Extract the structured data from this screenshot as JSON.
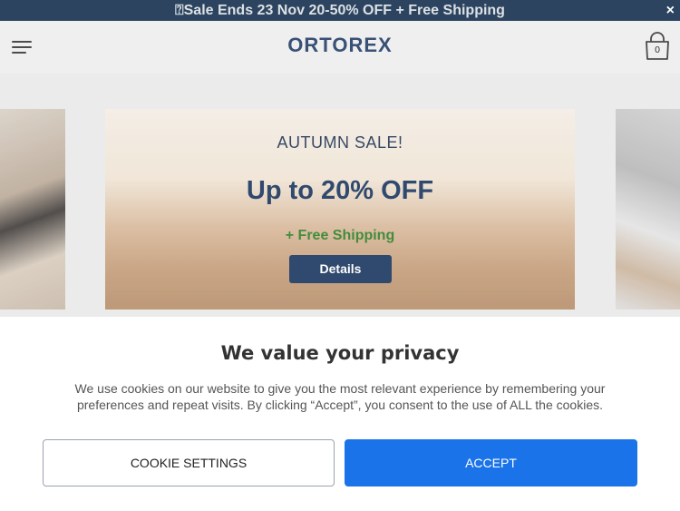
{
  "announcement": {
    "text": "⍰Sale Ends 23 Nov 20-50% OFF + Free Shipping",
    "close_label": "×"
  },
  "header": {
    "menu_icon": "hamburger-menu-icon",
    "logo": "ORTOREX",
    "cart_icon": "shopping-bag-icon",
    "cart_count": "0"
  },
  "promo": {
    "title": "AUTUMN SALE!",
    "headline": "Up to 20% OFF",
    "shipping": "+ Free Shipping",
    "button_label": "Details"
  },
  "cookie": {
    "title": "We value your privacy",
    "text": "We use cookies on our website to give you the most relevant experience by remembering your preferences and repeat visits. By clicking “Accept”, you consent to the use of ALL the cookies.",
    "settings_label": "COOKIE SETTINGS",
    "accept_label": "ACCEPT"
  },
  "colors": {
    "announcement_bg": "#0f2b4a",
    "brand": "#1d3a63",
    "promo_button": "#14305a",
    "shipping_text": "#2a7d22",
    "accept_button": "#1a73e8"
  }
}
